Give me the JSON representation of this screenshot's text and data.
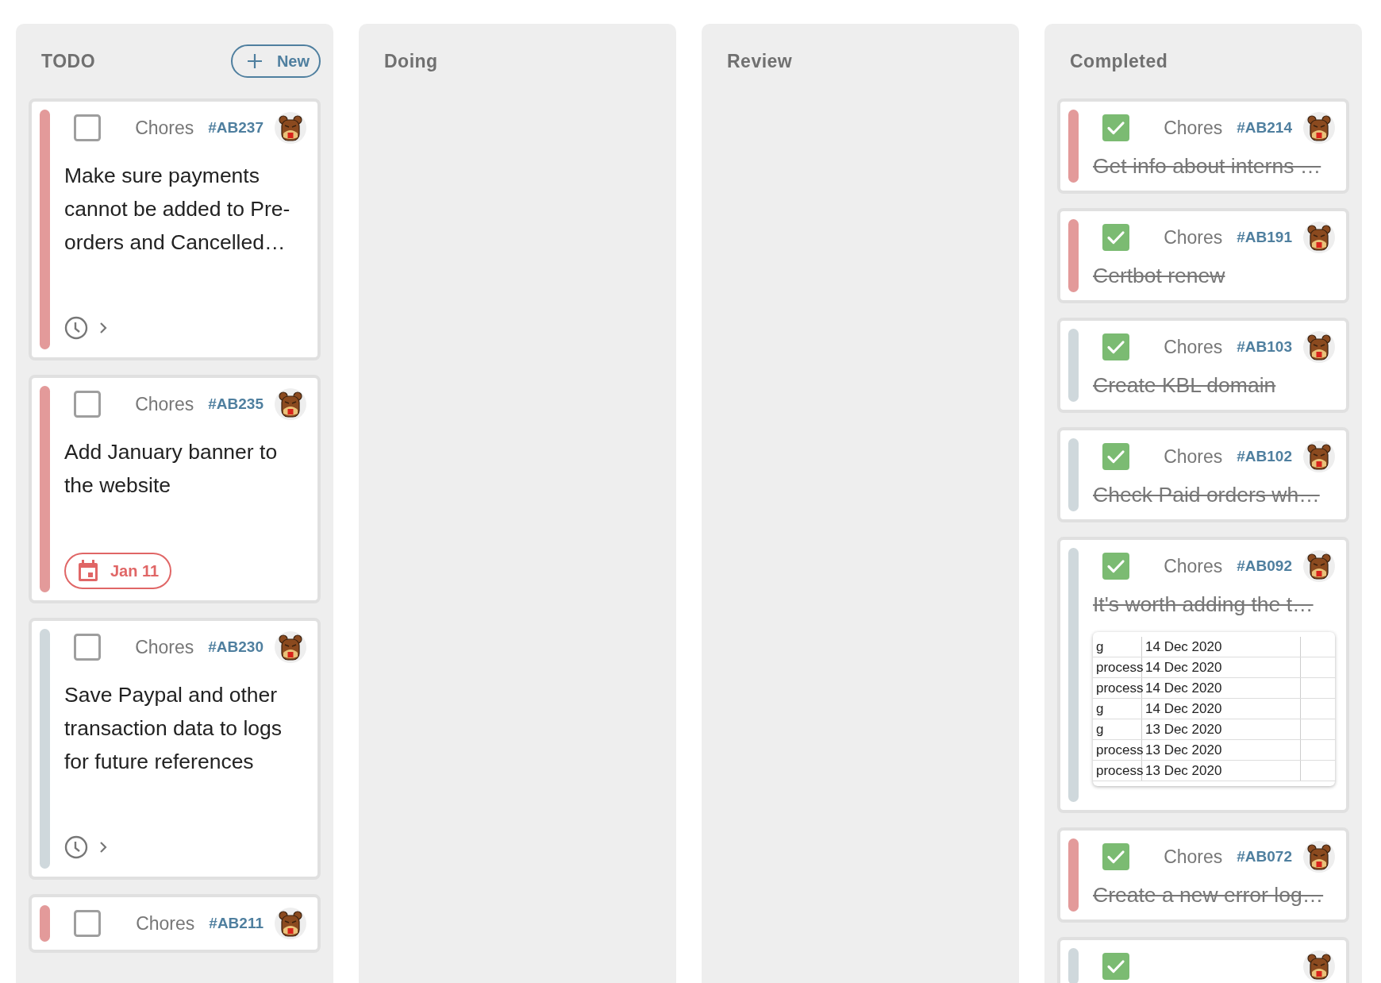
{
  "columns": [
    {
      "title": "TODO",
      "new_button": {
        "label": "New"
      },
      "cards": [
        {
          "checked": false,
          "category": "Chores",
          "id": "#AB237",
          "color": "#e39a9a",
          "title": "Make sure payments cannot be added to Pre-orders and Cancelled…",
          "footer": {
            "kind": "timer"
          }
        },
        {
          "checked": false,
          "category": "Chores",
          "id": "#AB235",
          "color": "#e39a9a",
          "title": "Add January banner to the website",
          "footer": {
            "kind": "due_date",
            "label": "Jan 11"
          }
        },
        {
          "checked": false,
          "category": "Chores",
          "id": "#AB230",
          "color": "#cfd8dc",
          "title": "Save Paypal and other transaction data to logs for future references",
          "footer": {
            "kind": "timer"
          }
        },
        {
          "checked": false,
          "category": "Chores",
          "id": "#AB211",
          "color": "#e39a9a"
        }
      ]
    },
    {
      "title": "Doing"
    },
    {
      "title": "Review"
    },
    {
      "title": "Completed",
      "cards": [
        {
          "checked": true,
          "category": "Chores",
          "id": "#AB214",
          "color": "#e39a9a",
          "title": "Get info about interns …"
        },
        {
          "checked": true,
          "category": "Chores",
          "id": "#AB191",
          "color": "#e39a9a",
          "title": "Certbot renew"
        },
        {
          "checked": true,
          "category": "Chores",
          "id": "#AB103",
          "color": "#cfd8dc",
          "title": "Create KBL domain"
        },
        {
          "checked": true,
          "category": "Chores",
          "id": "#AB102",
          "color": "#cfd8dc",
          "title": "Check Paid orders wh…"
        },
        {
          "checked": true,
          "category": "Chores",
          "id": "#AB092",
          "color": "#cfd8dc",
          "title": "It's worth adding the t…",
          "attachment": {
            "rows": [
              {
                "name": "g",
                "date": "14 Dec 2020"
              },
              {
                "name": "process",
                "date": "14 Dec 2020"
              },
              {
                "name": "process",
                "date": "14 Dec 2020"
              },
              {
                "name": "g",
                "date": "14 Dec 2020"
              },
              {
                "name": "g",
                "date": "13 Dec 2020"
              },
              {
                "name": "process",
                "date": "13 Dec 2020"
              },
              {
                "name": "process",
                "date": "13 Dec 2020"
              }
            ]
          }
        },
        {
          "checked": true,
          "category": "Chores",
          "id": "#AB072",
          "color": "#e39a9a",
          "title": "Create a new error log…"
        },
        {
          "checked": true,
          "color": "#cfd8dc"
        }
      ]
    }
  ]
}
